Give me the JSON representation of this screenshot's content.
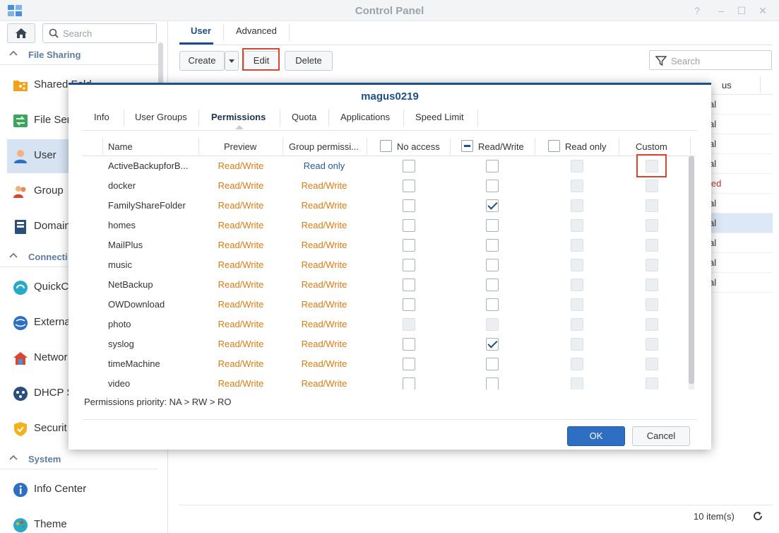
{
  "window": {
    "title": "Control Panel"
  },
  "sidebar": {
    "search_placeholder": "Search",
    "sections": [
      {
        "label": "File Sharing"
      },
      {
        "label": "Connecti"
      },
      {
        "label": "System"
      }
    ],
    "items": [
      {
        "label": "Shared Fold",
        "icon": "shared-folder-icon"
      },
      {
        "label": "File Ser",
        "icon": "file-services-icon"
      },
      {
        "label": "User",
        "icon": "user-icon"
      },
      {
        "label": "Group",
        "icon": "group-icon"
      },
      {
        "label": "Domain",
        "icon": "domain-icon"
      },
      {
        "label": "QuickC",
        "icon": "quickconnect-icon"
      },
      {
        "label": "Externa",
        "icon": "external-access-icon"
      },
      {
        "label": "Networ",
        "icon": "network-icon"
      },
      {
        "label": "DHCP S",
        "icon": "dhcp-server-icon"
      },
      {
        "label": "Securit",
        "icon": "security-icon"
      },
      {
        "label": "Info Center",
        "icon": "info-center-icon"
      },
      {
        "label": "Theme",
        "icon": "theme-icon"
      }
    ]
  },
  "main": {
    "tabs": [
      "User",
      "Advanced"
    ],
    "toolbar": {
      "create": "Create",
      "edit": "Edit",
      "delete": "Delete"
    },
    "search_placeholder": "Search",
    "header_status": "us",
    "status_cells": [
      "al",
      "al",
      "al",
      "al",
      "led",
      "al",
      "al",
      "al",
      "al",
      "al"
    ],
    "footer_count": "10 item(s)"
  },
  "dialog": {
    "title": "magus0219",
    "tabs": [
      "Info",
      "User Groups",
      "Permissions",
      "Quota",
      "Applications",
      "Speed Limit"
    ],
    "columns": {
      "name": "Name",
      "preview": "Preview",
      "group": "Group permissi...",
      "no_access": "No access",
      "read_write": "Read/Write",
      "read_only": "Read only",
      "custom": "Custom"
    },
    "rows": [
      {
        "name": "ActiveBackupforB...",
        "preview": "Read/Write",
        "group": "Read only"
      },
      {
        "name": "docker",
        "preview": "Read/Write",
        "group": "Read/Write"
      },
      {
        "name": "FamilyShareFolder",
        "preview": "Read/Write",
        "group": "Read/Write"
      },
      {
        "name": "homes",
        "preview": "Read/Write",
        "group": "Read/Write"
      },
      {
        "name": "MailPlus",
        "preview": "Read/Write",
        "group": "Read/Write"
      },
      {
        "name": "music",
        "preview": "Read/Write",
        "group": "Read/Write"
      },
      {
        "name": "NetBackup",
        "preview": "Read/Write",
        "group": "Read/Write"
      },
      {
        "name": "OWDownload",
        "preview": "Read/Write",
        "group": "Read/Write"
      },
      {
        "name": "photo",
        "preview": "Read/Write",
        "group": "Read/Write"
      },
      {
        "name": "syslog",
        "preview": "Read/Write",
        "group": "Read/Write"
      },
      {
        "name": "timeMachine",
        "preview": "Read/Write",
        "group": "Read/Write"
      },
      {
        "name": "video",
        "preview": "Read/Write",
        "group": "Read/Write"
      }
    ],
    "priority_note": "Permissions priority: NA > RW > RO",
    "ok": "OK",
    "cancel": "Cancel"
  },
  "colors": {
    "accent": "#1e4f8a",
    "preview_text": "#e07a10",
    "highlight": "#d9462f",
    "ok_button": "#2f6fc3"
  }
}
